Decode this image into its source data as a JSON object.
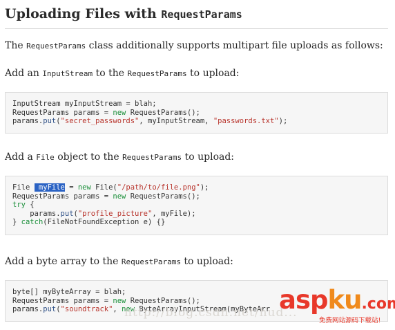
{
  "heading": {
    "text": "Uploading Files with ",
    "code": "RequestParams"
  },
  "intro": {
    "before": "The ",
    "code": "RequestParams",
    "after": " class additionally supports multipart file uploads as follows:"
  },
  "sections": [
    {
      "label": {
        "p1": "Add an ",
        "c1": "InputStream",
        "p2": " to the ",
        "c2": "RequestParams",
        "p3": " to upload:"
      },
      "code": {
        "l1a": "InputStream myInputStream = blah;",
        "l2a": "RequestParams params = ",
        "l2kw": "new",
        "l2b": " RequestParams();",
        "l3a": "params.",
        "l3m": "put",
        "l3b": "(",
        "l3s1": "\"secret_passwords\"",
        "l3c": ", myInputStream, ",
        "l3s2": "\"passwords.txt\"",
        "l3d": ");"
      }
    },
    {
      "label": {
        "p1": "Add a ",
        "c1": "File",
        "p2": " object to the ",
        "c2": "RequestParams",
        "p3": " to upload:"
      },
      "code": {
        "l1a": "File ",
        "l1sel": " myFile",
        "l1b": " = ",
        "l1kw": "new",
        "l1c": " Fi",
        "l1d": "le(",
        "l1s": "\"/path/to/file.png\"",
        "l1e": ");",
        "l2a": "RequestParams params",
        "l2b": " = ",
        "l2kw": "new",
        "l2c": " RequestParams();",
        "l3kw": "try",
        "l3b": " {",
        "l4a": "    params.",
        "l4m": "put",
        "l4b": "(",
        "l4s": "\"profile_picture\"",
        "l4c": ", myFile);",
        "l5a": "} ",
        "l5kw": "catch",
        "l5b": "(FileNotFoundException e) {}"
      }
    },
    {
      "label": {
        "p1": "Add a byte array to the ",
        "c2": "RequestParams",
        "p3": " to upload:"
      },
      "code": {
        "l1a": "byte[] myByteArray = blah;",
        "l2a": "RequestParams params = ",
        "l2kw": "new",
        "l2b": " RequestParams();",
        "l3a": "params.",
        "l3m": "put",
        "l3b": "(",
        "l3s1": "\"soundtrack\"",
        "l3c": ", ",
        "l3kw": "new",
        "l3d": " ByteArrayInputStream(myByteArr"
      }
    }
  ],
  "watermark": {
    "url": "http://blog.csdn.net/hud...",
    "logo_a": "asp",
    "logo_b": "ku",
    "logo_c": ".com",
    "logo_sub": "免费网站源码下载站!"
  },
  "colors": {
    "keyword": "#1b8f3a",
    "string": "#b8342c",
    "selection": "#2b63c4",
    "code_bg": "#f6f6f6"
  }
}
